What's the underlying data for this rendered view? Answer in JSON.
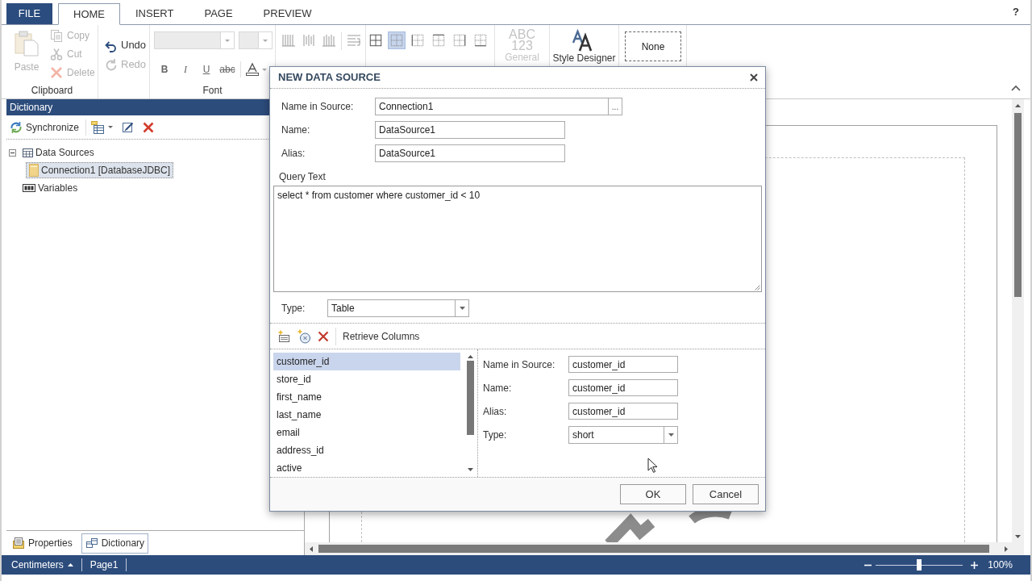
{
  "menu": {
    "tabs": [
      {
        "label": "FILE",
        "kind": "file",
        "selected": false
      },
      {
        "label": "HOME",
        "kind": "tab",
        "selected": true
      },
      {
        "label": "INSERT",
        "kind": "tab",
        "selected": false
      },
      {
        "label": "PAGE",
        "kind": "tab",
        "selected": false
      },
      {
        "label": "PREVIEW",
        "kind": "tab",
        "selected": false
      }
    ],
    "help": "?"
  },
  "ribbon": {
    "clipboard": {
      "title": "Clipboard",
      "paste": {
        "label": "Paste",
        "disabled": true
      },
      "items": [
        {
          "label": "Copy",
          "kind": "copy",
          "disabled": true
        },
        {
          "label": "Cut",
          "kind": "cut",
          "disabled": true
        },
        {
          "label": "Delete",
          "kind": "delete",
          "disabled": true
        }
      ]
    },
    "history": [
      {
        "label": "Undo",
        "kind": "undo",
        "disabled": false
      },
      {
        "label": "Redo",
        "kind": "redo",
        "disabled": true
      }
    ],
    "font": {
      "title": "Font",
      "styles": [
        {
          "label": "B",
          "kind": "bold"
        },
        {
          "label": "I",
          "kind": "italic"
        },
        {
          "label": "U",
          "kind": "underline"
        },
        {
          "label": "abc",
          "kind": "strike"
        }
      ]
    },
    "borders": [
      {
        "selected": false
      },
      {
        "selected": true
      },
      {
        "selected": false
      },
      {
        "selected": false
      },
      {
        "selected": false
      },
      {
        "selected": false
      }
    ],
    "format": {
      "sample": [
        "ABC",
        "123"
      ],
      "label": "General",
      "disabled": true
    },
    "style_designer": {
      "label": "Style Designer"
    },
    "style_preset": {
      "label": "None"
    }
  },
  "dictionary": {
    "title": "Dictionary",
    "synchronize": "Synchronize",
    "tree": [
      {
        "label": "Data Sources",
        "kind": "data_sources",
        "expanded": true,
        "selected": false,
        "children": [
          {
            "label": "Connection1 [DatabaseJDBC]",
            "kind": "connection",
            "selected": true
          }
        ]
      },
      {
        "label": "Variables",
        "kind": "variables",
        "selected": false
      }
    ],
    "tabs": [
      {
        "label": "Properties",
        "kind": "properties",
        "selected": false
      },
      {
        "label": "Dictionary",
        "kind": "dictionary",
        "selected": true
      }
    ]
  },
  "dialog": {
    "title": "NEW DATA SOURCE",
    "fields": [
      {
        "label": "Name in Source:",
        "value": "Connection1",
        "kind": "browse",
        "button": "..."
      },
      {
        "label": "Name:",
        "value": "DataSource1",
        "kind": "text"
      },
      {
        "label": "Alias:",
        "value": "DataSource1",
        "kind": "text"
      }
    ],
    "query": {
      "label": "Query Text",
      "value": "select * from customer where customer_id < 10"
    },
    "type": {
      "label": "Type:",
      "value": "Table"
    },
    "retrieve": "Retrieve Columns",
    "columns": [
      {
        "label": "customer_id",
        "selected": true
      },
      {
        "label": "store_id",
        "selected": false
      },
      {
        "label": "first_name",
        "selected": false
      },
      {
        "label": "last_name",
        "selected": false
      },
      {
        "label": "email",
        "selected": false
      },
      {
        "label": "address_id",
        "selected": false
      },
      {
        "label": "active",
        "selected": false
      }
    ],
    "column_fields": [
      {
        "label": "Name in Source:",
        "value": "customer_id",
        "kind": "text"
      },
      {
        "label": "Name:",
        "value": "customer_id",
        "kind": "text"
      },
      {
        "label": "Alias:",
        "value": "customer_id",
        "kind": "text"
      },
      {
        "label": "Type:",
        "value": "short",
        "kind": "select"
      }
    ],
    "buttons": [
      "OK",
      "Cancel"
    ]
  },
  "status_bar": {
    "units": "Centimeters",
    "page": "Page1",
    "zoom": {
      "level": 0.5,
      "reading": "100%"
    }
  }
}
